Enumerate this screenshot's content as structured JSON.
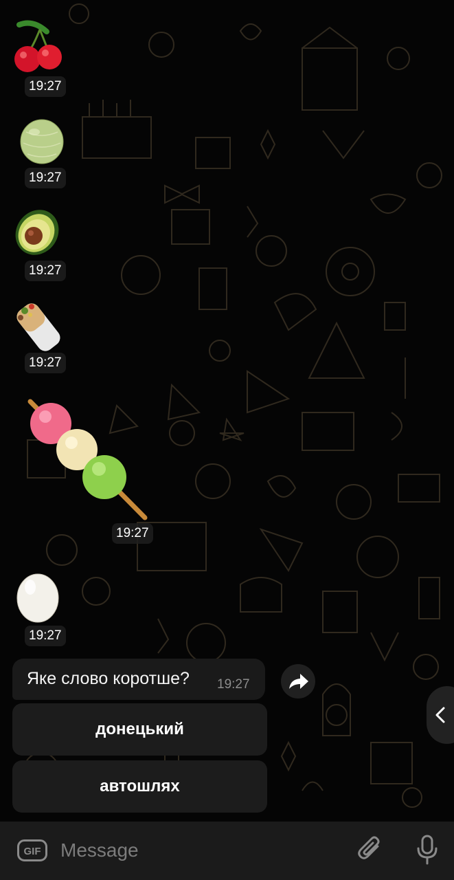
{
  "messages": [
    {
      "sticker": "cherries",
      "time": "19:27"
    },
    {
      "sticker": "melon",
      "time": "19:27"
    },
    {
      "sticker": "avocado",
      "time": "19:27"
    },
    {
      "sticker": "burrito",
      "time": "19:27"
    },
    {
      "sticker": "dango",
      "time": "19:27"
    },
    {
      "sticker": "egg",
      "time": "19:27"
    }
  ],
  "poll_message": {
    "text": "Яке слово коротше?",
    "time": "19:27"
  },
  "inline_buttons": [
    "донецький",
    "автошлях"
  ],
  "composer": {
    "placeholder": "Message",
    "gif_label": "GIF"
  },
  "icons": {
    "forward": "forward-arrow-icon",
    "side_tab": "chevron-left-icon",
    "attach": "paperclip-icon",
    "mic": "microphone-icon"
  },
  "colors": {
    "background": "#050505",
    "bubble": "#1a1a1a",
    "button": "#1c1c1c",
    "bottom_bar": "#1b1b1b",
    "placeholder": "#7c7c7c"
  }
}
